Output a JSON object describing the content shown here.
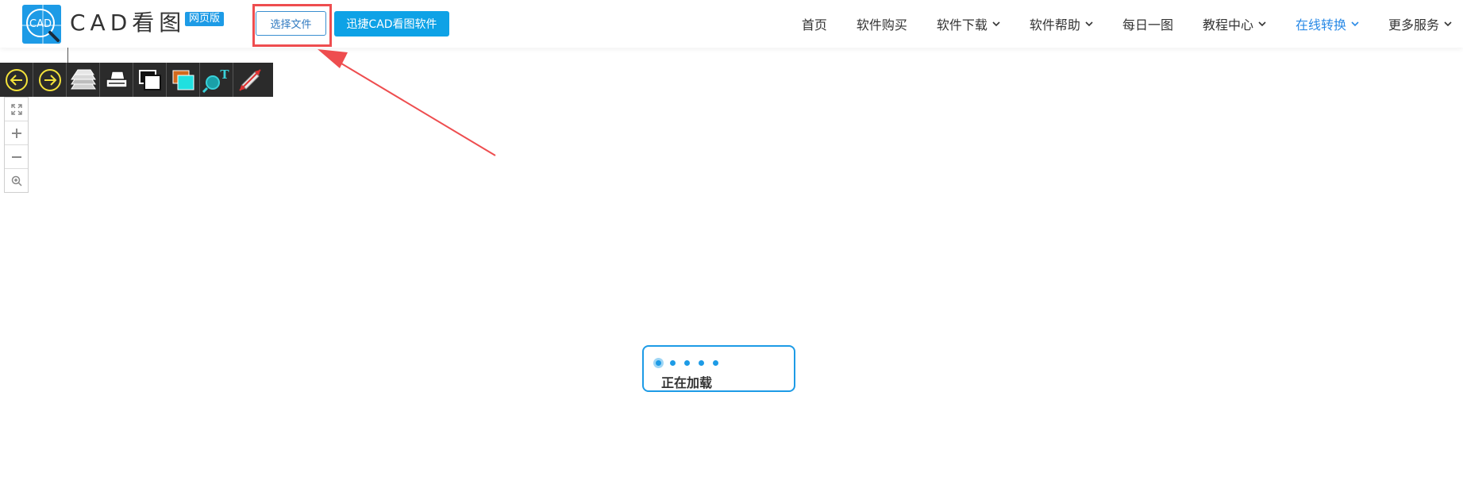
{
  "header": {
    "logo_text": "CAD",
    "brand_title": "CAD看图",
    "badge": "网页版",
    "select_file": "选择文件",
    "software_button": "迅捷CAD看图软件"
  },
  "nav": {
    "items": [
      {
        "label": "首页",
        "dropdown": false,
        "active": false
      },
      {
        "label": "软件购买",
        "dropdown": false,
        "active": false
      },
      {
        "label": "软件下载",
        "dropdown": true,
        "active": false
      },
      {
        "label": "软件帮助",
        "dropdown": true,
        "active": false
      },
      {
        "label": "每日一图",
        "dropdown": false,
        "active": false
      },
      {
        "label": "教程中心",
        "dropdown": true,
        "active": false
      },
      {
        "label": "在线转换",
        "dropdown": true,
        "active": true
      },
      {
        "label": "更多服务",
        "dropdown": true,
        "active": false
      }
    ]
  },
  "toolbar": {
    "tools": [
      "back-arrow-icon",
      "forward-arrow-icon",
      "layers-icon",
      "print-icon",
      "window-icon",
      "background-color-icon",
      "text-search-icon",
      "measure-icon"
    ]
  },
  "zoom": {
    "buttons": [
      "fit-screen-icon",
      "zoom-in-icon",
      "zoom-out-icon",
      "zoom-window-icon"
    ]
  },
  "loading": {
    "text": "正在加载"
  },
  "colors": {
    "brand": "#1d9be6",
    "active_nav": "#2a8ae6",
    "annotation": "#ee4d4f",
    "toolbar_bg": "#2b2b2b"
  }
}
